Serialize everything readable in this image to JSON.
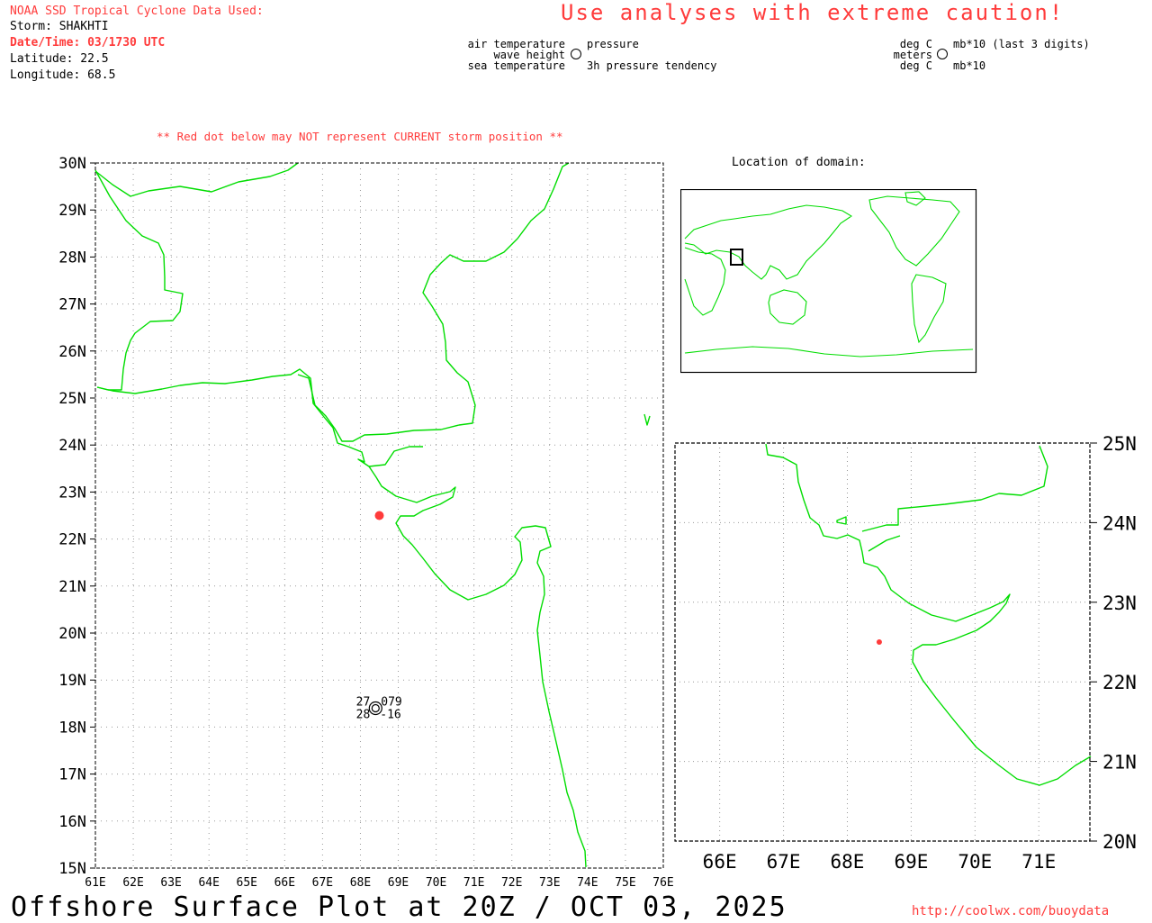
{
  "header": {
    "source_line": "NOAA SSD Tropical Cyclone Data Used:",
    "storm_line": "Storm: SHAKHTI",
    "datetime_line": "Date/Time: 03/1730 UTC",
    "latitude_line": "Latitude: 22.5",
    "longitude_line": "Longitude: 68.5",
    "caution": "Use analyses with extreme caution!"
  },
  "legend": {
    "left": {
      "air_temperature": "air temperature",
      "wave_height": "wave height",
      "sea_temperature": "sea temperature",
      "pressure": "pressure",
      "pressure_tendency": "3h pressure tendency"
    },
    "right": {
      "deg_c_top": "deg C",
      "meters": "meters",
      "deg_c_bottom": "deg C",
      "mb_top": "mb*10 (last 3 digits)",
      "mb_bottom": "mb*10"
    }
  },
  "warning": "** Red dot below may NOT represent CURRENT storm position **",
  "inset_title": "Location of domain:",
  "main_map": {
    "lat_labels": [
      "30N",
      "29N",
      "28N",
      "27N",
      "26N",
      "25N",
      "24N",
      "23N",
      "22N",
      "21N",
      "20N",
      "19N",
      "18N",
      "17N",
      "16N",
      "15N"
    ],
    "lon_labels": [
      "61E",
      "62E",
      "63E",
      "64E",
      "65E",
      "66E",
      "67E",
      "68E",
      "69E",
      "70E",
      "71E",
      "72E",
      "73E",
      "74E",
      "75E",
      "76E"
    ],
    "lat_range": [
      15,
      30
    ],
    "lon_range": [
      61,
      76
    ]
  },
  "zoom_map": {
    "lat_labels": [
      "25N",
      "24N",
      "23N",
      "22N",
      "21N",
      "20N"
    ],
    "lon_labels": [
      "66E",
      "67E",
      "68E",
      "69E",
      "70E",
      "71E"
    ],
    "lat_range": [
      20,
      25
    ],
    "lon_range": [
      65.3,
      71.8
    ]
  },
  "storm": {
    "lat": 22.5,
    "lon": 68.5,
    "color": "#ff3b3b"
  },
  "station": {
    "lat": 18.4,
    "lon": 68.4,
    "air_temperature": "27",
    "pressure": "079",
    "sea_temperature": "28",
    "pressure_tendency": "-16"
  },
  "colors": {
    "coast": "#00dd00",
    "accent": "#ff3b3b",
    "grid": "#999999"
  },
  "footer": {
    "title": "Offshore Surface Plot at 20Z / OCT 03, 2025",
    "url": "http://coolwx.com/buoydata"
  }
}
